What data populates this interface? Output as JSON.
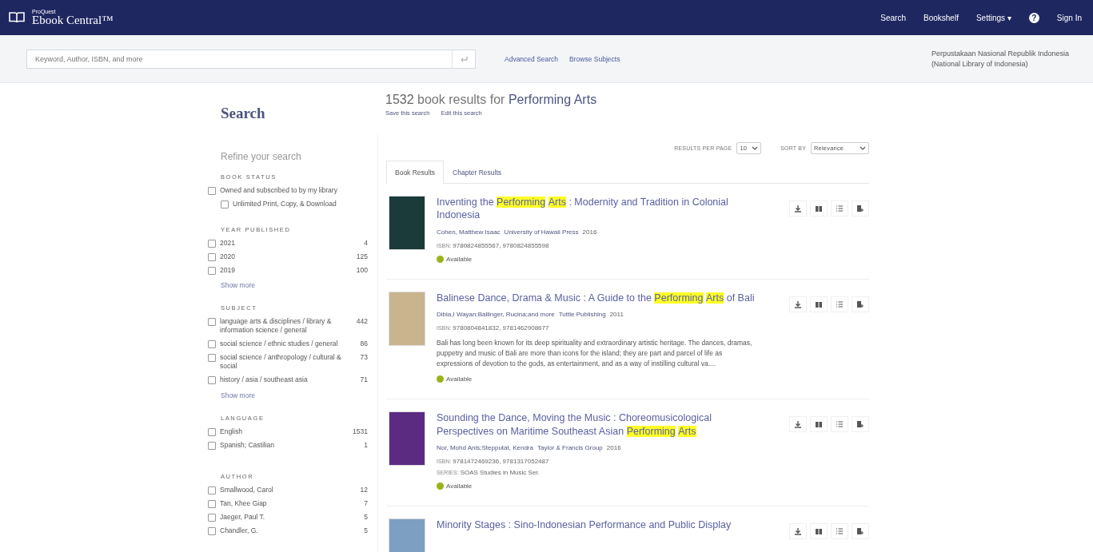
{
  "header": {
    "brand_small": "ProQuest",
    "brand": "Ebook Central™",
    "nav": [
      "Search",
      "Bookshelf"
    ],
    "settings": "Settings ▾",
    "help": "?",
    "sign_in": "Sign In"
  },
  "searchbar": {
    "placeholder": "Keyword, Author, ISBN, and more",
    "links": [
      "Advanced Search",
      "Browse Subjects"
    ],
    "library": [
      "Perpustakaan Nasional Republik Indonesia",
      "(National Library of Indonesia)"
    ]
  },
  "sidebar": {
    "title": "Search",
    "refine": "Refine your search",
    "facets": [
      {
        "heading": "BOOK STATUS",
        "items": [
          {
            "label": "Owned and subscribed to by my library",
            "checked": false,
            "children": [
              {
                "label": "Unlimited Print, Copy, & Download",
                "checked": false
              }
            ]
          }
        ]
      },
      {
        "heading": "YEAR PUBLISHED",
        "items": [
          {
            "label": "2021",
            "count": "4",
            "checked": false
          },
          {
            "label": "2020",
            "count": "125",
            "checked": false
          },
          {
            "label": "2019",
            "count": "100",
            "checked": false
          }
        ],
        "more": "Show more"
      },
      {
        "heading": "SUBJECT",
        "items": [
          {
            "label": "language arts & disciplines / library & information science / general",
            "count": "442",
            "checked": false
          },
          {
            "label": "social science / ethnic studies / general",
            "count": "86",
            "checked": false
          },
          {
            "label": "social science / anthropology / cultural & social",
            "count": "73",
            "checked": false
          },
          {
            "label": "history / asia / southeast asia",
            "count": "71",
            "checked": false
          }
        ],
        "more": "Show more"
      },
      {
        "heading": "LANGUAGE",
        "items": [
          {
            "label": "English",
            "count": "1531",
            "checked": false
          },
          {
            "label": "Spanish; Castilian",
            "count": "1",
            "checked": false
          }
        ]
      },
      {
        "heading": "AUTHOR",
        "items": [
          {
            "label": "Smallwood, Carol",
            "count": "12",
            "checked": false
          },
          {
            "label": "Tan, Khee Giap",
            "count": "7",
            "checked": false
          },
          {
            "label": "Jaeger, Paul T.",
            "count": "5",
            "checked": false
          },
          {
            "label": "Chandler, G.",
            "count": "5",
            "checked": false
          }
        ]
      }
    ]
  },
  "results": {
    "count": "1532",
    "summary": "book results for",
    "query": "Performing Arts",
    "actions": [
      "Save this search",
      "Edit this search"
    ],
    "per_page_label": "RESULTS PER PAGE",
    "per_page": "10",
    "sort_label": "SORT BY",
    "sort": "Relevance",
    "tabs": [
      {
        "label": "Book Results",
        "selected": true
      },
      {
        "label": "Chapter Results",
        "selected": false
      }
    ],
    "items": [
      {
        "title": [
          {
            "text": "Inventing the ",
            "highlighted": false
          },
          {
            "text": "Performing",
            "highlighted": true
          },
          {
            "text": "Arts",
            "highlighted": true
          },
          {
            "text": " : Modernity and Tradition in Colonial Indonesia",
            "highlighted": false
          }
        ],
        "authors": "Cohen, Matthew Isaac",
        "publisher": "University of Hawaii Press",
        "year": "2016",
        "isbn_label": "ISBN:",
        "isbn": "9780824855567, 9780824855598",
        "status": "Available",
        "available": true
      },
      {
        "title": [
          {
            "text": "Balinese Dance, Drama & Music : A Guide to the ",
            "highlighted": false
          },
          {
            "text": "Performing",
            "highlighted": true
          },
          {
            "text": "Arts",
            "highlighted": true
          },
          {
            "text": " of Bali",
            "highlighted": false
          }
        ],
        "authors": "Dibia,I Wayan;Ballinger, Rucina;and more",
        "publisher": "Tuttle Publishing",
        "year": "2011",
        "isbn_label": "ISBN:",
        "isbn": "9780804841832, 9781462908677",
        "description": "Bali has long been known for its deep spirituality and extraordinary artistic heritage. The dances, dramas, puppetry and music of Bali are more than icons for the island; they are part and parcel of life as expressions of devotion to the gods, as entertainment, and as a way of instilling cultural va....",
        "status": "Available",
        "available": true
      },
      {
        "title": [
          {
            "text": "Sounding the Dance, Moving the Music : Choreomusicological Perspectives on Maritime Southeast Asian ",
            "highlighted": false
          },
          {
            "text": "Performing",
            "highlighted": true
          },
          {
            "text": "Arts",
            "highlighted": true
          }
        ],
        "authors": "Nor, Mohd Anis;Stepputat, Kendra",
        "publisher": "Taylor & Francis Group",
        "year": "2016",
        "isbn_label": "ISBN:",
        "isbn": "9781472469236, 9781317052487",
        "series_label": "SERIES:",
        "series": "SOAS Studies in Music Ser.",
        "status": "Available",
        "available": true
      },
      {
        "title": [
          {
            "text": "Minority Stages : Sino-Indonesian Performance and Public Display",
            "highlighted": false
          }
        ]
      }
    ]
  }
}
